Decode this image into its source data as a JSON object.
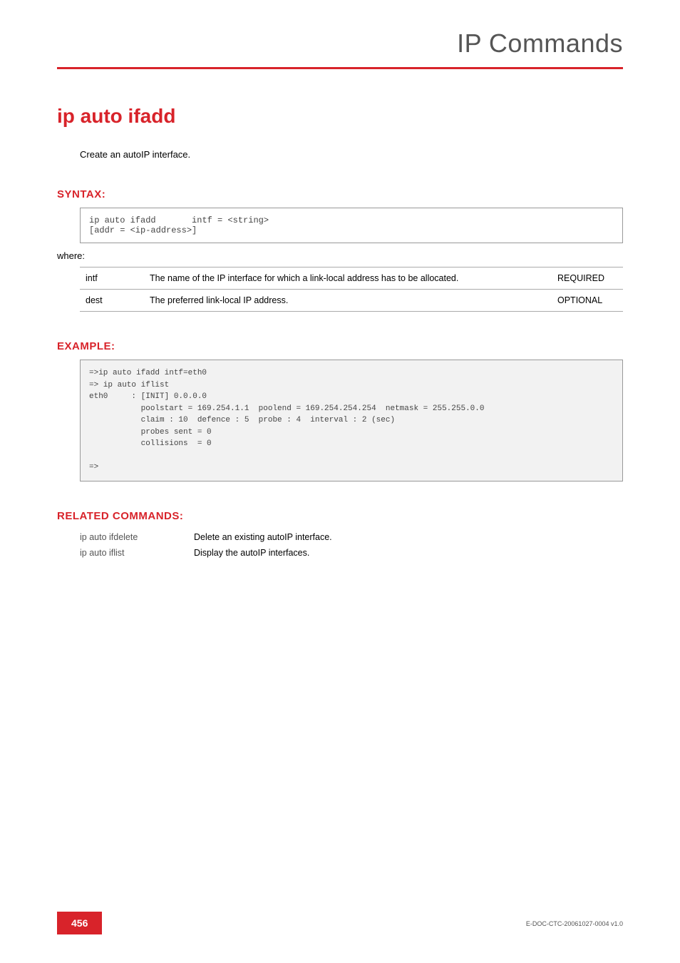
{
  "header": "IP Commands",
  "title": "ip auto ifadd",
  "description": "Create an autoIP interface.",
  "syntax": {
    "heading": "SYNTAX:",
    "command": "ip auto ifadd",
    "args": "intf = <string>\n[addr = <ip-address>]",
    "where": "where:",
    "params": [
      {
        "name": "intf",
        "desc": "The name of the IP interface for which a link-local address has to be allocated.",
        "req": "REQUIRED"
      },
      {
        "name": "dest",
        "desc": "The preferred link-local IP address.",
        "req": "OPTIONAL"
      }
    ]
  },
  "example": {
    "heading": "EXAMPLE:",
    "text": "=>ip auto ifadd intf=eth0\n=> ip auto iflist\neth0     : [INIT] 0.0.0.0\n           poolstart = 169.254.1.1  poolend = 169.254.254.254  netmask = 255.255.0.0\n           claim : 10  defence : 5  probe : 4  interval : 2 (sec)\n           probes sent = 0\n           collisions  = 0\n\n=>"
  },
  "related": {
    "heading": "RELATED COMMANDS:",
    "items": [
      {
        "cmd": "ip auto ifdelete",
        "desc": "Delete an existing autoIP interface."
      },
      {
        "cmd": "ip auto iflist",
        "desc": "Display the autoIP interfaces."
      }
    ]
  },
  "footer": {
    "page": "456",
    "docid": "E-DOC-CTC-20061027-0004 v1.0"
  }
}
